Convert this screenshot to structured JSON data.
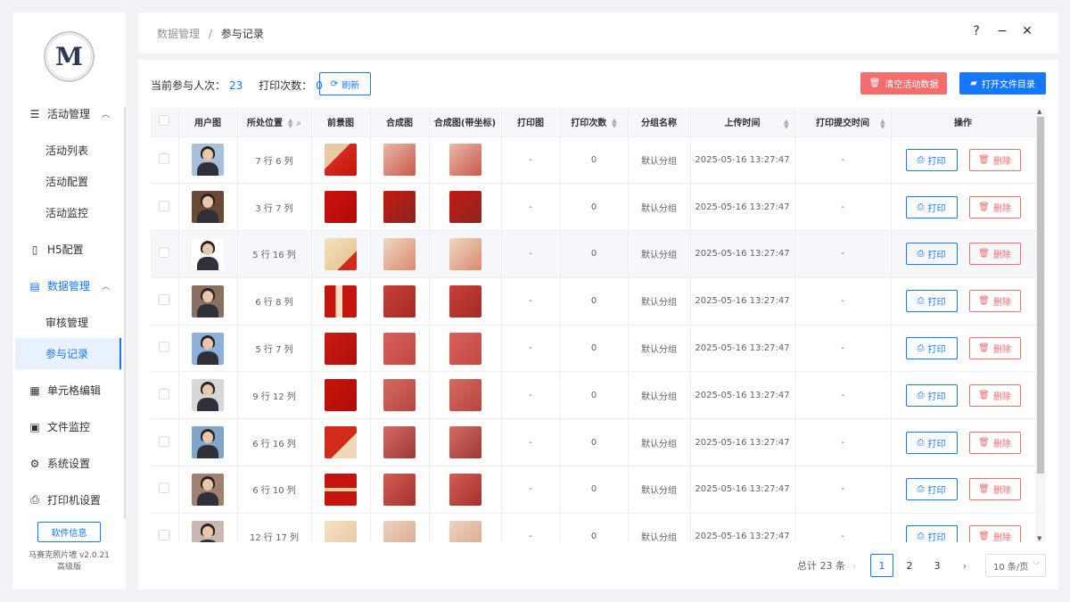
{
  "sidebar": {
    "logo_letter": "M",
    "menu": {
      "activity_mgmt": "活动管理",
      "activity_list": "活动列表",
      "activity_config": "活动配置",
      "activity_monitor": "活动监控",
      "h5_config": "H5配置",
      "data_mgmt": "数据管理",
      "review_mgmt": "审核管理",
      "participation_records": "参与记录",
      "cell_editor": "单元格编辑",
      "file_monitor": "文件监控",
      "system_settings": "系统设置",
      "printer_settings": "打印机设置"
    },
    "software_info_label": "软件信息",
    "version_line1": "马赛克照片墙 v2.0.21",
    "version_line2": "高级版"
  },
  "header": {
    "breadcrumb_parent": "数据管理",
    "breadcrumb_separator": "/",
    "breadcrumb_current": "参与记录",
    "help": "?",
    "minimize": "−",
    "close": "✕"
  },
  "toolbar": {
    "participants_label": "当前参与人次：",
    "participants_value": "23",
    "prints_label": "打印次数：",
    "prints_value": "0",
    "refresh_label": "刷新",
    "clear_label": "清空活动数据",
    "open_dir_label": "打开文件目录"
  },
  "table": {
    "columns": [
      "用户图",
      "所处位置",
      "前景图",
      "合成图",
      "合成图(带坐标)",
      "打印图",
      "打印次数",
      "分组名称",
      "上传时间",
      "打印提交时间",
      "操作"
    ],
    "print_btn": "打印",
    "delete_btn": "删除",
    "rows": [
      {
        "position": "7 行 6 列",
        "print_img": "-",
        "print_count": "0",
        "group": "默认分组",
        "upload_time": "2025-05-16 13:27:47",
        "submit_time": "-"
      },
      {
        "position": "3 行 7 列",
        "print_img": "-",
        "print_count": "0",
        "group": "默认分组",
        "upload_time": "2025-05-16 13:27:47",
        "submit_time": "-"
      },
      {
        "position": "5 行 16 列",
        "print_img": "-",
        "print_count": "0",
        "group": "默认分组",
        "upload_time": "2025-05-16 13:27:47",
        "submit_time": "-"
      },
      {
        "position": "6 行 8 列",
        "print_img": "-",
        "print_count": "0",
        "group": "默认分组",
        "upload_time": "2025-05-16 13:27:47",
        "submit_time": "-"
      },
      {
        "position": "5 行 7 列",
        "print_img": "-",
        "print_count": "0",
        "group": "默认分组",
        "upload_time": "2025-05-16 13:27:47",
        "submit_time": "-"
      },
      {
        "position": "9 行 12 列",
        "print_img": "-",
        "print_count": "0",
        "group": "默认分组",
        "upload_time": "2025-05-16 13:27:47",
        "submit_time": "-"
      },
      {
        "position": "6 行 16 列",
        "print_img": "-",
        "print_count": "0",
        "group": "默认分组",
        "upload_time": "2025-05-16 13:27:47",
        "submit_time": "-"
      },
      {
        "position": "6 行 10 列",
        "print_img": "-",
        "print_count": "0",
        "group": "默认分组",
        "upload_time": "2025-05-16 13:27:47",
        "submit_time": "-"
      },
      {
        "position": "12 行 17 列",
        "print_img": "-",
        "print_count": "0",
        "group": "默认分组",
        "upload_time": "2025-05-16 13:27:47",
        "submit_time": "-"
      }
    ]
  },
  "pagination": {
    "total_label": "总计 23 条",
    "pages": [
      "1",
      "2",
      "3"
    ],
    "current_page": "1",
    "page_size": "10 条/页",
    "prev": "‹",
    "next": "›"
  },
  "colors": {
    "accent": "#1677ff",
    "danger": "#f56c6c",
    "background": "#f0f2f5"
  }
}
